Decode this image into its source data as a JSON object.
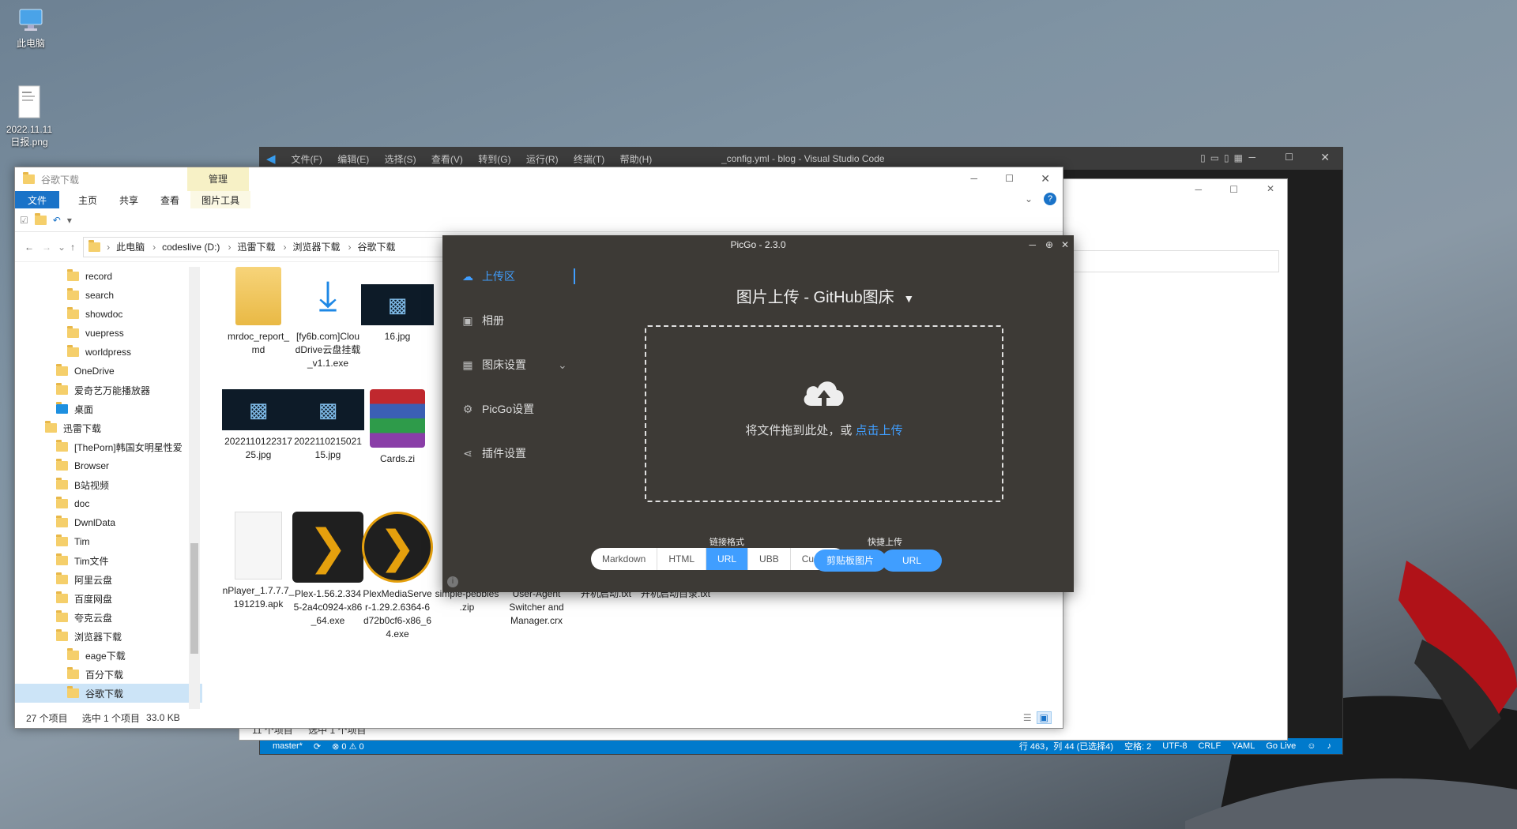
{
  "desktop": {
    "icons": [
      {
        "label": "此电脑"
      },
      {
        "label": "2022.11.11 日报.png"
      }
    ]
  },
  "vscode": {
    "menu": [
      "文件(F)",
      "编辑(E)",
      "选择(S)",
      "查看(V)",
      "转到(G)",
      "运行(R)",
      "终端(T)",
      "帮助(H)"
    ],
    "title": "_config.yml - blog - Visual Studio Code",
    "status": {
      "branch": "master*",
      "problems": "⊗ 0 ⚠ 0",
      "position": "行 463，列 44 (已选择4)",
      "spaces": "空格: 2",
      "encoding": "UTF-8",
      "eol": "CRLF",
      "lang": "YAML",
      "live": "Go Live"
    }
  },
  "explorer2": {
    "status": {
      "count": "11 个项目",
      "selected": "选中 1 个项目"
    }
  },
  "explorer": {
    "title": "谷歌下载",
    "manage_tab": "管理",
    "tabs": [
      "文件",
      "主页",
      "共享",
      "查看",
      "图片工具"
    ],
    "breadcrumb": [
      "此电脑",
      "codeslive (D:)",
      "迅雷下载",
      "浏览器下载",
      "谷歌下载"
    ],
    "tree": [
      {
        "label": "record",
        "indent": 2
      },
      {
        "label": "search",
        "indent": 2
      },
      {
        "label": "showdoc",
        "indent": 2
      },
      {
        "label": "vuepress",
        "indent": 2
      },
      {
        "label": "worldpress",
        "indent": 2
      },
      {
        "label": "OneDrive",
        "indent": 1
      },
      {
        "label": "爱奇艺万能播放器",
        "indent": 1
      },
      {
        "label": "桌面",
        "indent": 1
      },
      {
        "label": "迅雷下载",
        "indent": 0
      },
      {
        "label": "[ThePorn]韩国女明星性爱",
        "indent": 1
      },
      {
        "label": "Browser",
        "indent": 1
      },
      {
        "label": "B站视频",
        "indent": 1
      },
      {
        "label": "doc",
        "indent": 1
      },
      {
        "label": "DwnlData",
        "indent": 1
      },
      {
        "label": "Tim",
        "indent": 1
      },
      {
        "label": "Tim文件",
        "indent": 1
      },
      {
        "label": "阿里云盘",
        "indent": 1
      },
      {
        "label": "百度网盘",
        "indent": 1
      },
      {
        "label": "夸克云盘",
        "indent": 1
      },
      {
        "label": "浏览器下载",
        "indent": 1
      },
      {
        "label": "eage下载",
        "indent": 2
      },
      {
        "label": "百分下载",
        "indent": 2
      },
      {
        "label": "谷歌下载",
        "indent": 2
      }
    ],
    "files": [
      {
        "name": "mrdoc_report_\nmd",
        "kind": "folder"
      },
      {
        "name": "[fy6b.com]Clou\ndDrive云盘挂载\n_v1.1.exe",
        "kind": "download"
      },
      {
        "name": "16.jpg",
        "kind": "jpg"
      },
      {
        "name": "2022110122317\n25.jpg",
        "kind": "jpg"
      },
      {
        "name": "2022110215021\n15.jpg",
        "kind": "jpg"
      },
      {
        "name": "Cards.zi",
        "kind": "rar"
      },
      {
        "name": "nPlayer_1.7.7.7_\n191219.apk",
        "kind": "doc"
      },
      {
        "name": "Plex-1.56.2.334\n5-2a4c0924-x86\n_64.exe",
        "kind": "plex"
      },
      {
        "name": "PlexMediaServe\nr-1.29.2.6364-6\nd72b0cf6-x86_6\n4.exe",
        "kind": "plex2"
      },
      {
        "name": "simple-pebbles\n.zip",
        "kind": "none"
      },
      {
        "name": "User-Agent\nSwitcher and\nManager.crx",
        "kind": "none"
      },
      {
        "name": "开机启动.txt",
        "kind": "none"
      },
      {
        "name": "开机启动目录.txt",
        "kind": "none"
      }
    ],
    "status": {
      "count": "27 个项目",
      "selected": "选中 1 个项目",
      "size": "33.0 KB"
    }
  },
  "picgo": {
    "title": "PicGo - 2.3.0",
    "nav": [
      {
        "label": "上传区",
        "icon": "cloud-icon",
        "glyph": "☁"
      },
      {
        "label": "相册",
        "icon": "image-icon",
        "glyph": "▣"
      },
      {
        "label": "图床设置",
        "icon": "grid-icon",
        "glyph": "▦"
      },
      {
        "label": "PicGo设置",
        "icon": "gear-icon",
        "glyph": "⚙"
      },
      {
        "label": "插件设置",
        "icon": "share-icon",
        "glyph": "⋖"
      }
    ],
    "heading": "图片上传 - GitHub图床",
    "drop_text": "将文件拖到此处，或",
    "drop_link": "点击上传",
    "link_format_label": "链接格式",
    "formats": [
      "Markdown",
      "HTML",
      "URL",
      "UBB",
      "Custom"
    ],
    "selected_format": "URL",
    "quick_upload_label": "快捷上传",
    "clipboard_btn": "剪贴板图片",
    "url_btn": "URL",
    "colors": {
      "accent": "#409eff",
      "bg": "#3d3a36"
    }
  }
}
